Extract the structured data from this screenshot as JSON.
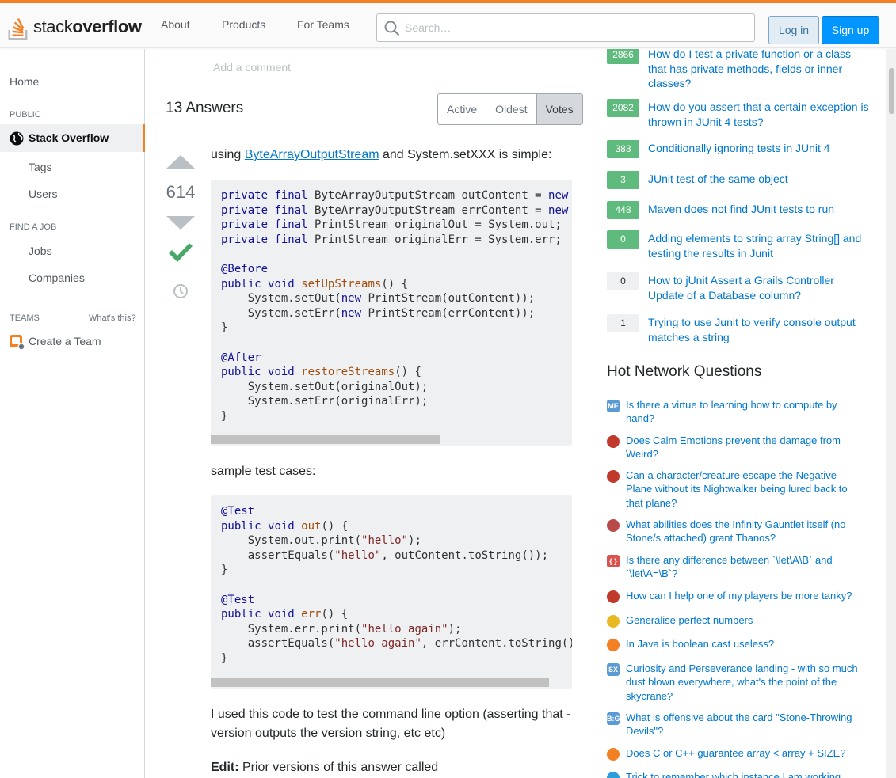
{
  "header": {
    "logo_word1": "stack",
    "logo_word2": "overflow",
    "nav": [
      "About",
      "Products",
      "For Teams"
    ],
    "search_placeholder": "Search…",
    "login": "Log in",
    "signup": "Sign up",
    "accent": "#f48024"
  },
  "sidebar": {
    "home": "Home",
    "public_heading": "PUBLIC",
    "stack_overflow": "Stack Overflow",
    "tags": "Tags",
    "users": "Users",
    "find_job_heading": "FIND A JOB",
    "jobs": "Jobs",
    "companies": "Companies",
    "teams_heading": "TEAMS",
    "whats_this": "What's this?",
    "create_team": "Create a Team"
  },
  "main": {
    "add_comment": "Add a comment",
    "answers_count": "13 Answers",
    "tabs": [
      "Active",
      "Oldest",
      "Votes"
    ],
    "vote_count": "614",
    "intro_prefix": "using ",
    "intro_link": "ByteArrayOutputStream",
    "intro_suffix": " and System.setXXX is simple:",
    "sample_label": "sample test cases:",
    "para_used": "I used this code to test the command line option (asserting that -version outputs the version string, etc etc)",
    "edit_label": "Edit:",
    "edit_text": " Prior versions of this answer called"
  },
  "linked": [
    {
      "score": "2866",
      "title": "How do I test a private function or a class that has private methods, fields or inner classes?",
      "accepted": true
    },
    {
      "score": "2082",
      "title": "How do you assert that a certain exception is thrown in JUnit 4 tests?",
      "accepted": true
    },
    {
      "score": "383",
      "title": "Conditionally ignoring tests in JUnit 4",
      "accepted": true
    },
    {
      "score": "3",
      "title": "JUnit test of the same object",
      "accepted": true
    },
    {
      "score": "448",
      "title": "Maven does not find JUnit tests to run",
      "accepted": true
    },
    {
      "score": "0",
      "title": "Adding elements to string array String[] and testing the results in Junit",
      "accepted": true
    },
    {
      "score": "0",
      "title": "How to jUnit Assert a Grails Controller Update of a Database column?",
      "accepted": false
    },
    {
      "score": "1",
      "title": "Trying to use Junit to verify console output matches a string",
      "accepted": false
    }
  ],
  "hot_network": {
    "title": "Hot Network Questions",
    "items": [
      {
        "icon": "matheducators-icon",
        "icon_text": "ME",
        "color": "#5b9bd5",
        "text": "Is there a virtue to learning how to compute by hand?"
      },
      {
        "icon": "rpg-icon",
        "icon_text": "",
        "color": "#c0392b",
        "text": "Does Calm Emotions prevent the damage from Weird?"
      },
      {
        "icon": "rpg-icon",
        "icon_text": "",
        "color": "#c0392b",
        "text": "Can a character/creature escape the Negative Plane without its Nightwalker being lured back to that plane?"
      },
      {
        "icon": "scifi-icon",
        "icon_text": "",
        "color": "#b84a4a",
        "text": "What abilities does the Infinity Gauntlet itself (no Stone/s attached) grant Thanos?"
      },
      {
        "icon": "tex-icon",
        "icon_text": "{ }",
        "color": "#d9534f",
        "text": "Is there any difference between `\\let\\A\\B` and `\\let\\A=\\B`?"
      },
      {
        "icon": "rpg-icon",
        "icon_text": "",
        "color": "#c0392b",
        "text": "How can I help one of my players be more tanky?"
      },
      {
        "icon": "puzzling-icon",
        "icon_text": "",
        "color": "#e8b923",
        "text": "Generalise perfect numbers"
      },
      {
        "icon": "stackoverflow-icon",
        "icon_text": "",
        "color": "#f48024",
        "text": "In Java is boolean cast useless?"
      },
      {
        "icon": "space-icon",
        "icon_text": "SX",
        "color": "#5b9bd5",
        "text": "Curiosity and Perseverance landing - with so much dust blown everywhere, what's the point of the skycrane?"
      },
      {
        "icon": "boardgames-icon",
        "icon_text": "B:G",
        "color": "#5b9bd5",
        "text": "What is offensive about the card \"Stone-Throwing Devils\"?"
      },
      {
        "icon": "stackoverflow-icon",
        "icon_text": "",
        "color": "#f48024",
        "text": "Does C or C++ guarantee array < array + SIZE?"
      },
      {
        "icon": "superuser-icon",
        "icon_text": "",
        "color": "#2d9cdb",
        "text": "Trick to remember which instance I am working"
      }
    ]
  }
}
